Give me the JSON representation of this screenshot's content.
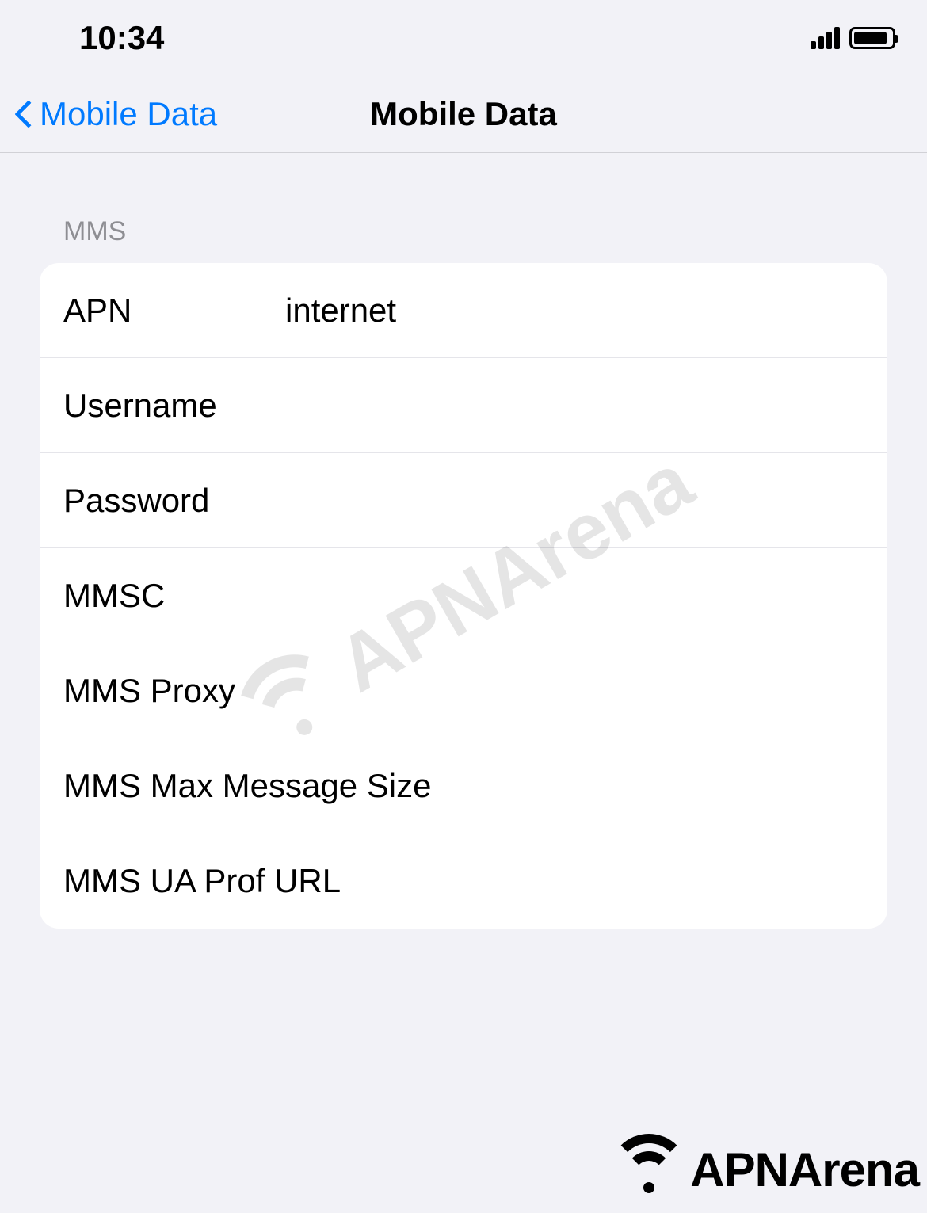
{
  "status_bar": {
    "time": "10:34"
  },
  "nav": {
    "back_label": "Mobile Data",
    "title": "Mobile Data"
  },
  "section": {
    "header": "MMS"
  },
  "fields": {
    "apn": {
      "label": "APN",
      "value": "internet"
    },
    "username": {
      "label": "Username",
      "value": ""
    },
    "password": {
      "label": "Password",
      "value": ""
    },
    "mmsc": {
      "label": "MMSC",
      "value": ""
    },
    "mms_proxy": {
      "label": "MMS Proxy",
      "value": ""
    },
    "mms_max_size": {
      "label": "MMS Max Message Size",
      "value": ""
    },
    "mms_ua_prof": {
      "label": "MMS UA Prof URL",
      "value": ""
    }
  },
  "watermark": "APNArena",
  "branding": "APNArena"
}
